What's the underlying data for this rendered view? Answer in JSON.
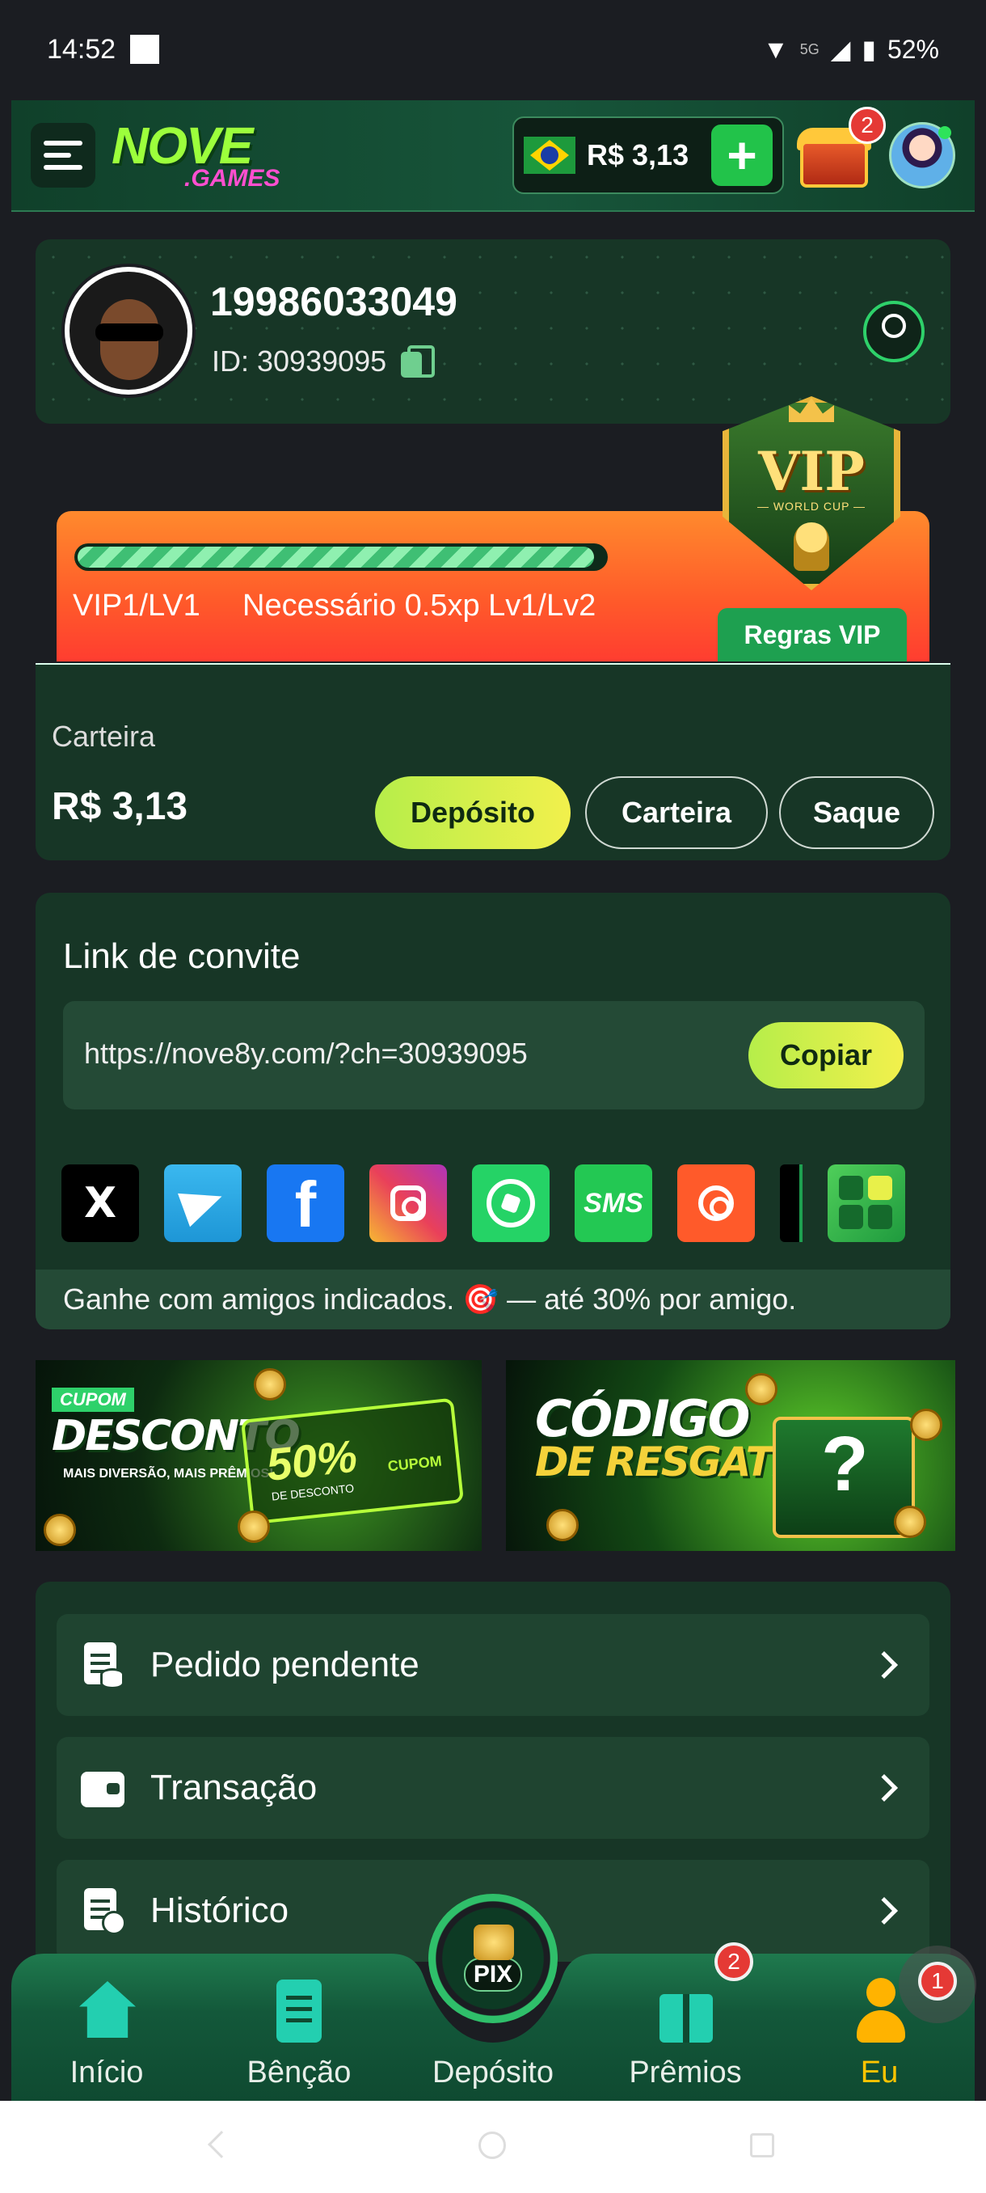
{
  "status_bar": {
    "time": "14:52",
    "network": "5G",
    "battery": "52%"
  },
  "header": {
    "logo_top": "NOVE",
    "logo_bottom": ".GAMES",
    "balance": "R$ 3,13",
    "plus_label": "+",
    "chest_badge": "2"
  },
  "profile": {
    "username": "19986033049",
    "id_text": "ID: 30939095"
  },
  "vip": {
    "progress_fraction": 0.98,
    "level": "VIP1/LV1",
    "requirement": "Necessário 0.5xp Lv1/Lv2",
    "rules_label": "Regras VIP",
    "shield_text": "VIP",
    "shield_sub": "— WORLD CUP —"
  },
  "wallet": {
    "label": "Carteira",
    "amount": "R$ 3,13",
    "deposit_label": "Depósito",
    "wallet_label": "Carteira",
    "withdraw_label": "Saque"
  },
  "invite": {
    "title": "Link de convite",
    "url": "https://nove8y.com/?ch=30939095",
    "copy_label": "Copiar",
    "footer": "Ganhe com amigos indicados. 🎯 — até 30% por amigo.",
    "socials": {
      "x": "X",
      "facebook": "f",
      "sms": "SMS"
    }
  },
  "promos": {
    "left": {
      "tag": "CUPOM",
      "title": "DESCONTO",
      "subtitle": "MAIS DIVERSÃO, MAIS PRÊMIOS!",
      "percent": "50%",
      "percent_sub": "DE DESCONTO",
      "coupon": "CUPOM"
    },
    "right": {
      "title1": "CÓDIGO",
      "title2": "DE RESGATE",
      "symbol": "?"
    }
  },
  "menu": {
    "pending": "Pedido pendente",
    "transactions": "Transação",
    "history": "Histórico"
  },
  "bottom_nav": {
    "home": "Início",
    "blessing": "Bênção",
    "deposit": "Depósito",
    "rewards": "Prêmios",
    "me": "Eu",
    "pix_label": "PIX",
    "rewards_badge": "2",
    "float_badge": "1"
  },
  "colors": {
    "accent_green": "#22c34a",
    "active_nav": "#ffc400",
    "badge_red": "#e53935"
  }
}
